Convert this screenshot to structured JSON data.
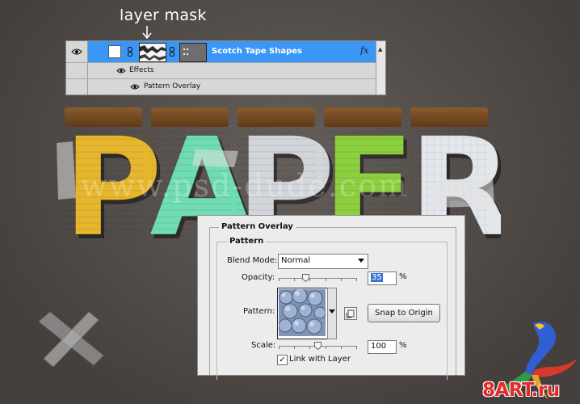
{
  "annotation": {
    "caption": "layer mask"
  },
  "layers_panel": {
    "layer": {
      "name": "Scotch Tape Shapes",
      "fx_label": "fx"
    },
    "sub_rows": [
      {
        "label": "Effects"
      },
      {
        "label": "Pattern Overlay"
      }
    ]
  },
  "artwork": {
    "headline": "PAPER",
    "watermark": "www.psd-dude.com",
    "letter_colors": [
      "#e6b72e",
      "#6fdcb4",
      "#d2d6db",
      "#8ccf3f",
      "#e3e6ea"
    ]
  },
  "dialog": {
    "title": "Pattern Overlay",
    "section": "Pattern",
    "blend_mode": {
      "label": "Blend Mode:",
      "value": "Normal"
    },
    "opacity": {
      "label": "Opacity:",
      "value": "35",
      "unit": "%",
      "level": 0.35
    },
    "pattern": {
      "label": "Pattern:"
    },
    "snap_button": "Snap to Origin",
    "scale": {
      "label": "Scale:",
      "value": "100",
      "unit": "%",
      "level": 0.5
    },
    "link_checkbox": {
      "label": "Link with Layer",
      "checked": true,
      "check_glyph": "✓"
    }
  },
  "logo": {
    "text": "8ART.ru"
  }
}
